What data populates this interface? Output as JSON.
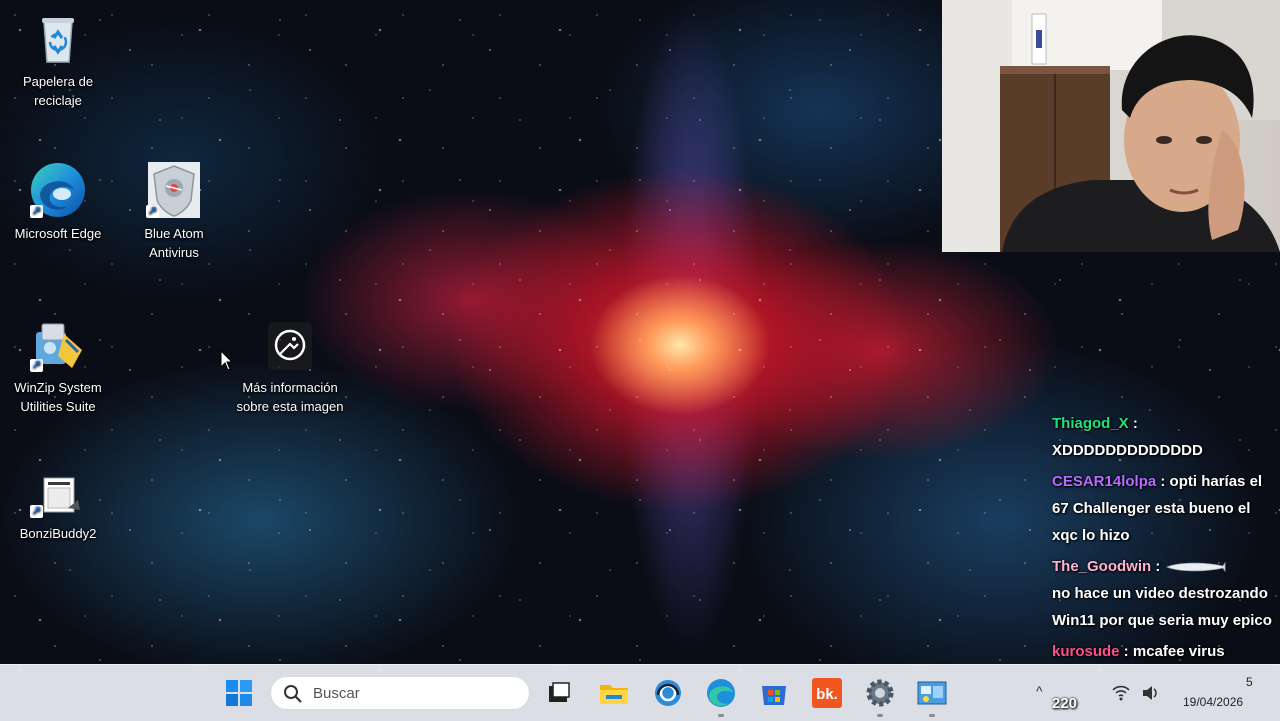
{
  "desktop": {
    "icons": [
      {
        "label": "Papelera de reciclaje",
        "icon": "recycle-bin-icon"
      },
      {
        "label": "Microsoft Edge",
        "icon": "edge-icon"
      },
      {
        "label": "Blue Atom Antivirus",
        "icon": "antivirus-shield-icon"
      },
      {
        "label": "WinZip System Utilities Suite",
        "icon": "winzip-icon"
      },
      {
        "label": "Más información sobre esta imagen",
        "icon": "image-info-icon"
      },
      {
        "label": "BonziBuddy2",
        "icon": "bonzibuddy-icon"
      }
    ]
  },
  "chat": {
    "messages": [
      {
        "user": "Thiagod_X",
        "user_color": "#22e07a",
        "text": "XDDDDDDDDDDDDD"
      },
      {
        "user": "CESAR14lolpa",
        "user_color": "#b86bff",
        "text": "opti harías el 67 Challenger esta bueno el xqc lo hizo"
      },
      {
        "user": "The_Goodwin",
        "user_color": "#ffb3d1",
        "text": "no hace un video destrozando Win11 por que seria muy epico"
      },
      {
        "user": "kurosude",
        "user_color": "#ff4f8a",
        "text": "mcafee virus"
      }
    ],
    "viewer_count": "220"
  },
  "taskbar": {
    "search_placeholder": "Buscar",
    "apps": [
      "start-icon",
      "task-view-icon",
      "file-explorer-icon",
      "support-icon",
      "edge-icon",
      "store-icon",
      "bk-app-icon",
      "settings-icon",
      "control-panel-icon"
    ],
    "tray": {
      "time_partial": "5",
      "date": "19/04/2026"
    }
  },
  "colors": {
    "taskbar_bg": "#eef0f6",
    "accent": "#0078d4"
  }
}
